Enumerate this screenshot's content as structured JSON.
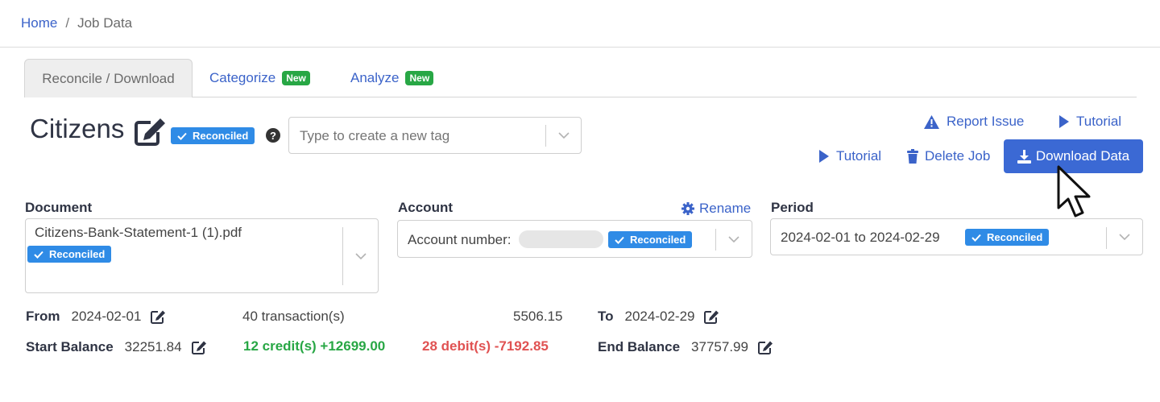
{
  "breadcrumb": {
    "home": "Home",
    "separator": "/",
    "current": "Job Data"
  },
  "tabs": [
    {
      "label": "Reconcile / Download",
      "badge": ""
    },
    {
      "label": "Categorize",
      "badge": "New"
    },
    {
      "label": "Analyze",
      "badge": "New"
    }
  ],
  "job": {
    "title": "Citizens",
    "status": "Reconciled",
    "help": "?"
  },
  "tag_input": {
    "placeholder": "Type to create a new tag"
  },
  "actions": {
    "report_issue": "Report Issue",
    "tutorial_top": "Tutorial",
    "tutorial": "Tutorial",
    "delete_job": "Delete Job",
    "download": "Download Data"
  },
  "document": {
    "label": "Document",
    "value": "Citizens-Bank-Statement-1 (1).pdf",
    "status": "Reconciled"
  },
  "account": {
    "label": "Account",
    "rename": "Rename",
    "value": "Account number:",
    "status": "Reconciled"
  },
  "period": {
    "label": "Period",
    "value": "2024-02-01 to 2024-02-29",
    "status": "Reconciled"
  },
  "summary": {
    "from_label": "From",
    "from_value": "2024-02-01",
    "transactions": "40 transaction(s)",
    "amount": "5506.15",
    "to_label": "To",
    "to_value": "2024-02-29",
    "start_label": "Start Balance",
    "start_value": "32251.84",
    "credits": "12 credit(s) +12699.00",
    "debits": "28 debit(s) -7192.85",
    "end_label": "End Balance",
    "end_value": "37757.99"
  },
  "colors": {
    "accent": "#3b69d4",
    "link": "#3b63c9",
    "badge": "#2f8be6",
    "success": "#28a745",
    "danger": "#e05252"
  }
}
